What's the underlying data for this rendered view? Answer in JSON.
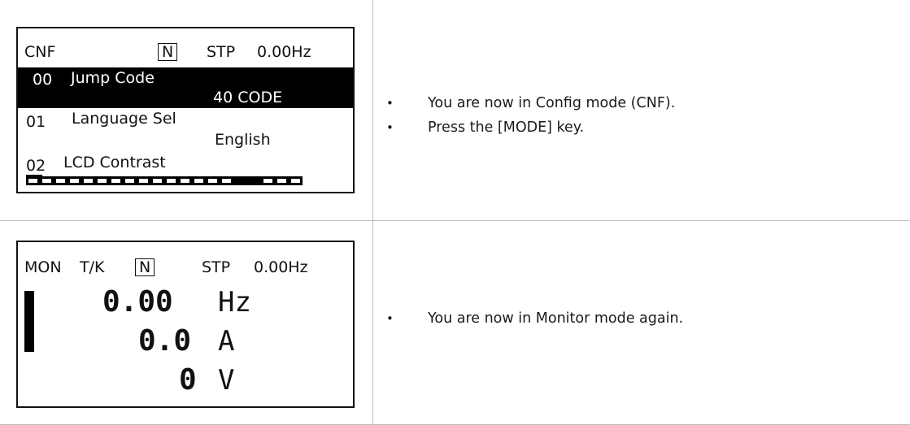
{
  "steps": [
    {
      "lcd": {
        "mode": "CNF",
        "indicator": "N",
        "status": "STP",
        "freq": "0.00Hz",
        "items": [
          {
            "code": "00",
            "name": "Jump Code",
            "value": "40 CODE"
          },
          {
            "code": "01",
            "name": "Language Sel",
            "value": "English"
          },
          {
            "code": "02",
            "name": "LCD Contrast"
          }
        ],
        "contrast_level": 0.85
      },
      "bullets": [
        "You are now in Config mode (CNF).",
        "Press the [MODE] key."
      ]
    },
    {
      "lcd": {
        "mode": "MON",
        "sub": "T/K",
        "indicator": "N",
        "status": "STP",
        "freq": "0.00Hz",
        "readings": [
          {
            "value": "0.00",
            "unit": "Hz"
          },
          {
            "value": "0.0",
            "unit": "A"
          },
          {
            "value": "0",
            "unit": "V"
          }
        ]
      },
      "bullets": [
        "You are now in Monitor mode again."
      ]
    }
  ],
  "bullet_char": "•"
}
